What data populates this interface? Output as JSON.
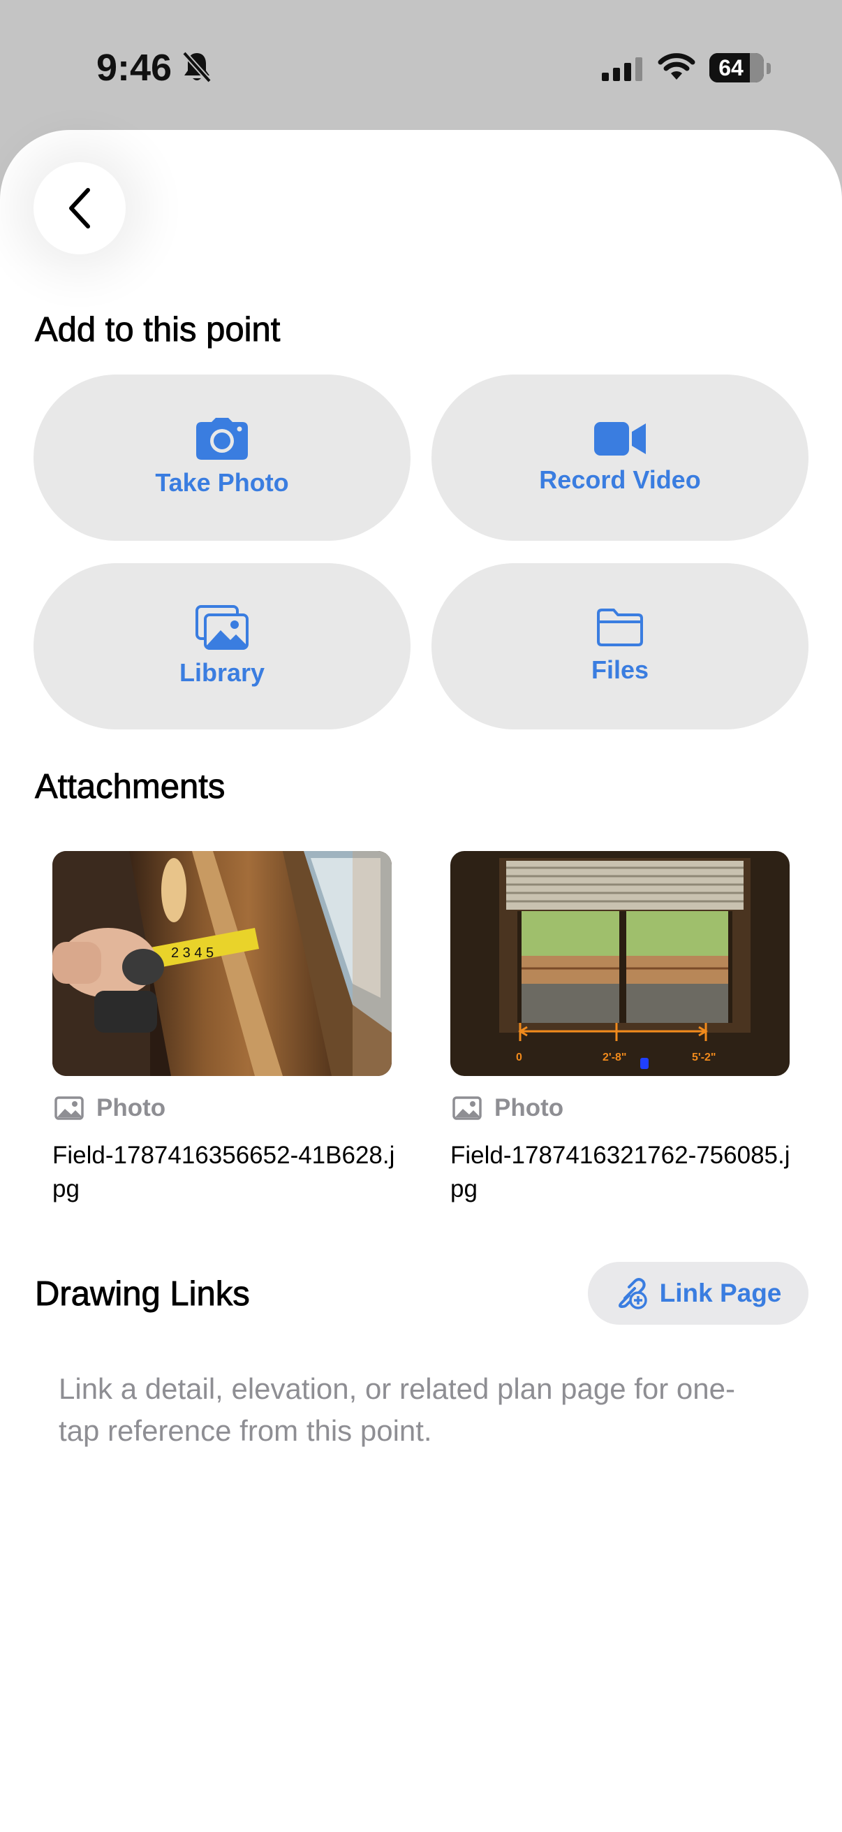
{
  "status_bar": {
    "time": "9:46",
    "battery": "64",
    "icons": [
      "bell-slash-icon",
      "cellular-signal-icon",
      "wifi-icon",
      "battery-icon"
    ]
  },
  "header": {
    "back_icon": "chevron-left-icon"
  },
  "add_section": {
    "title": "Add to this point",
    "actions": [
      {
        "label": "Take Photo",
        "icon": "camera-icon"
      },
      {
        "label": "Record Video",
        "icon": "video-camera-icon"
      },
      {
        "label": "Library",
        "icon": "photo-library-icon"
      },
      {
        "label": "Files",
        "icon": "folder-icon"
      }
    ]
  },
  "attachments": {
    "title": "Attachments",
    "items": [
      {
        "type": "Photo",
        "file_name": "Field-1787416356652-41B628.jpg",
        "image": "tape-measure-window-frame"
      },
      {
        "type": "Photo",
        "file_name": "Field-1787416321762-756085.jpg",
        "image": "window-with-dimension-lines",
        "dimension_labels": [
          "0",
          "2'-8\"",
          "5'-2\""
        ]
      }
    ]
  },
  "drawing_links": {
    "title": "Drawing Links",
    "button_label": "Link Page",
    "button_icon": "link-plus-icon",
    "hint": "Link a detail, elevation, or related plan page for one-tap reference from this point."
  },
  "colors": {
    "accent": "#3a7de0",
    "button_bg": "#e8e8e8",
    "secondary_text": "#8e8e93",
    "status_bg": "#c4c4c4"
  }
}
